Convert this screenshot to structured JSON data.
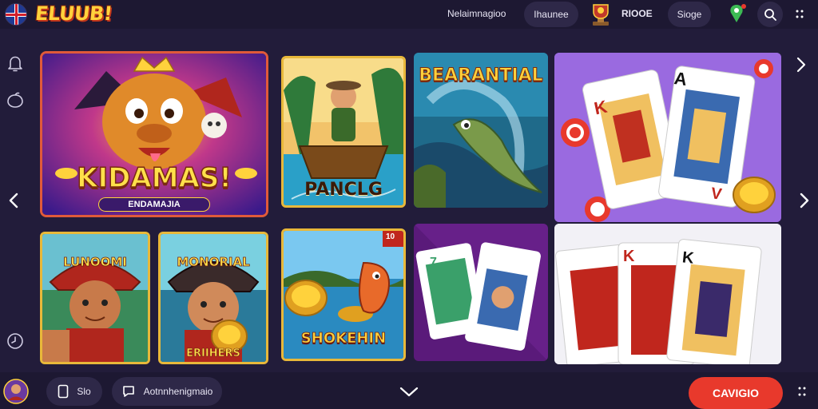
{
  "header": {
    "logo_text": "ELUUB!",
    "nav_link": "Nelaimnagioo",
    "pill_1": "Ihaunee",
    "profile_text": "RIOOE",
    "pill_2": "Sioge",
    "icons": [
      "uk-flag-icon",
      "trophy-icon",
      "map-pin-icon",
      "search-icon",
      "more-vertical-icon"
    ]
  },
  "sidebar": {
    "icons": [
      "bell-icon",
      "pumpkin-icon",
      "clock-icon"
    ]
  },
  "tiles": {
    "kidamas": {
      "title": "KIDAMAS!",
      "subtitle": "ENDAMAJIA"
    },
    "panclg": {
      "title": "PANCLG"
    },
    "bearantial": {
      "title": "BEARANTIAL"
    },
    "shokehin": {
      "title": "SHOKEHIN",
      "badge": "10"
    },
    "worker1": {
      "title": "LUNOOMI"
    },
    "worker2": {
      "title": "MONORIAL",
      "caption": "ERIIHERS"
    }
  },
  "cards": {
    "k": "K",
    "a": "A",
    "v": "V",
    "seven": "7"
  },
  "footer": {
    "tab_1": "Slo",
    "tab_2": "Aotnnhenigmaio",
    "cta_label": "CAVIGIO"
  },
  "colors": {
    "background": "#221c3a",
    "bar": "#1d1832",
    "pill": "#2e2848",
    "accent": "#e8392c",
    "gold": "#ffd23c"
  }
}
